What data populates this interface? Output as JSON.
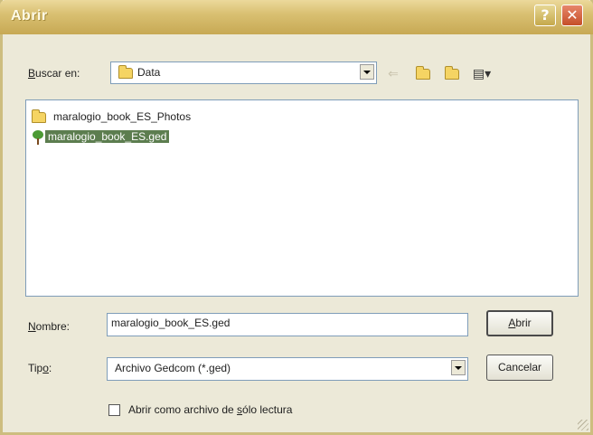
{
  "window": {
    "title": "Abrir",
    "help_glyph": "?",
    "close_glyph": "✕"
  },
  "lookin": {
    "label_prefix": "",
    "label_underlined": "B",
    "label_rest": "uscar en:",
    "value": "Data"
  },
  "toolbar": {
    "back_glyph": "⇐",
    "up_glyph": "⇧",
    "newfolder_glyph": "✱",
    "views_glyph": "▤▾"
  },
  "files": [
    {
      "name": "maralogio_book_ES_Photos",
      "icon": "folder-icon",
      "selected": false
    },
    {
      "name": "maralogio_book_ES.ged",
      "icon": "family-tree-icon",
      "selected": true
    }
  ],
  "filename": {
    "label_underlined": "N",
    "label_rest": "ombre:",
    "value": "maralogio_book_ES.ged"
  },
  "filetype": {
    "label_prefix": "Tip",
    "label_underlined": "o",
    "label_rest": ":",
    "value": "Archivo Gedcom (*.ged)"
  },
  "buttons": {
    "open_underlined": "A",
    "open_rest": "brir",
    "cancel": "Cancelar"
  },
  "readonly": {
    "label_prefix": "Abrir como archivo de ",
    "label_underlined": "s",
    "label_rest": "ólo lectura",
    "checked": false
  }
}
